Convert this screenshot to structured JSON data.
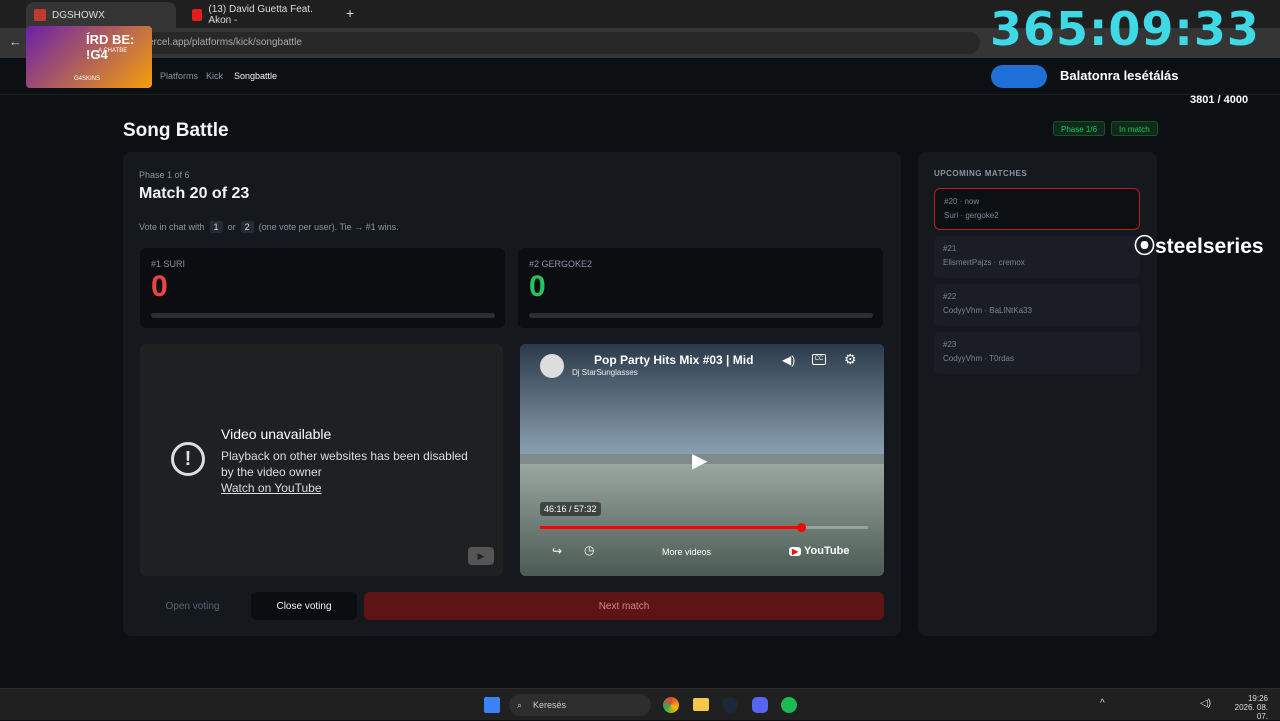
{
  "tabs": [
    {
      "label": "DGSHOWX"
    },
    {
      "label": "(13) David Guetta Feat. Akon - "
    }
  ],
  "url": "ercel.app/platforms/kick/songbattle",
  "stream": {
    "promo": "ÍRD BE: !G4",
    "promo_sub": "A CHATBE",
    "brand": "G4SKINS",
    "timer": "365:09:33",
    "goal_label": "Balatonra lesétálás",
    "goal_count": "3801 / 4000",
    "sponsor": "steelseries",
    "goal_color": "#1f6fd6"
  },
  "nav": {
    "platforms": "Platforms",
    "kick": "Kick",
    "songbattle": "Songbattle"
  },
  "page": {
    "title": "Song Battle",
    "phase_badge": "Phase 1/6",
    "status_badge": "In match"
  },
  "battle": {
    "phase": "Phase 1 of 6",
    "match": "Match 20 of 23",
    "instr_pre": "Vote in chat with",
    "key1": "1",
    "or": "or",
    "key2": "2",
    "instr_post": "(one vote per user). Tie → #1 wins.",
    "left": {
      "label": "#1 SURI",
      "score": "0",
      "color": "#ef4444"
    },
    "right": {
      "label": "#2 GERGOKE2",
      "score": "0",
      "color": "#22c55e"
    }
  },
  "video_left": {
    "title": "Video unavailable",
    "msg1": "Playback on other websites has been disabled",
    "msg2": "by the video owner",
    "link": "Watch on YouTube"
  },
  "video_right": {
    "title": "Pop Party Hits Mix #03 | Mid",
    "channel": "Dj StarSunglasses",
    "time": "46:16 / 57:32",
    "more": "More videos",
    "brand": "YouTube",
    "progress": 0.8
  },
  "controls": {
    "open": "Open voting",
    "close": "Close voting",
    "next": "Next match"
  },
  "upcoming": {
    "heading": "UPCOMING MATCHES",
    "items": [
      {
        "num": "#20 · now",
        "players": "Suri · gergoke2"
      },
      {
        "num": "#21",
        "players": "ElismertPajzs · cremox"
      },
      {
        "num": "#22",
        "players": "CodyyVhm · BaLlNtKa33"
      },
      {
        "num": "#23",
        "players": "CodyyVhm · T0rdas"
      }
    ]
  },
  "taskbar": {
    "search": "Keresés",
    "time": "19:26",
    "date": "2026. 08. 07."
  }
}
